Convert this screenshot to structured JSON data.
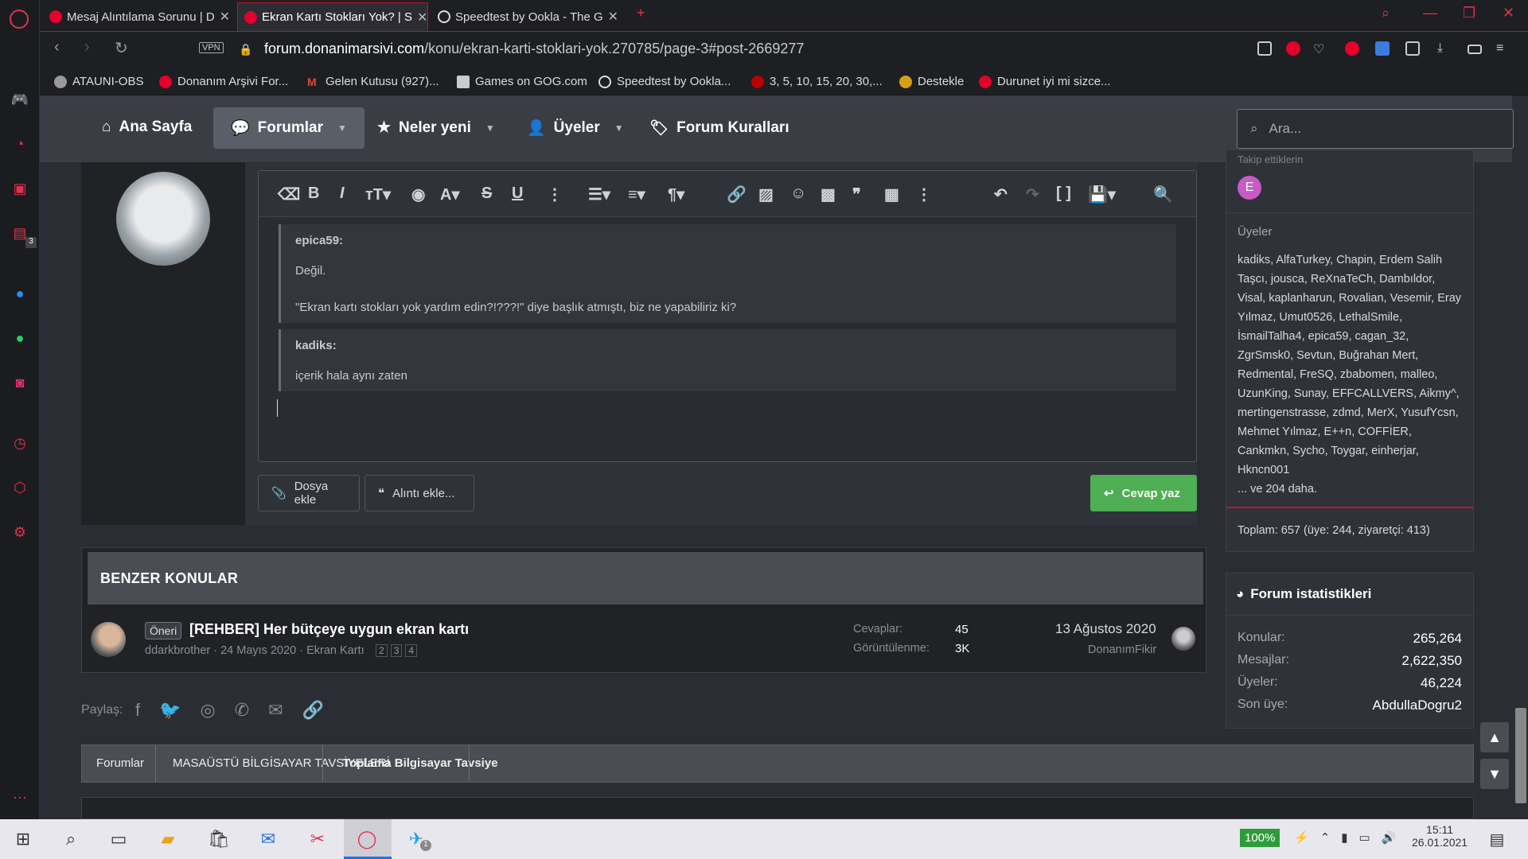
{
  "browser": {
    "tabs": [
      {
        "label": "Mesaj Alıntılama Sorunu | D"
      },
      {
        "label": "Ekran Kartı Stokları Yok? | S"
      },
      {
        "label": "Speedtest by Ookla - The G"
      }
    ],
    "vpn": "VPN",
    "url_domain": "forum.donanimarsivi.com",
    "url_path": "/konu/ekran-karti-stoklari-yok.270785/page-3#post-2669277",
    "bookmarks": [
      "ATAUNI-OBS",
      "Donanım Arşivi For...",
      "Gelen Kutusu (927)...",
      "Games on GOG.com",
      "Speedtest by Ookla...",
      "3, 5, 10, 15, 20, 30,...",
      "Destekle",
      "Durunet iyi mi sizce..."
    ],
    "sidebar_badge": "3"
  },
  "nav": {
    "items": [
      "Ana Sayfa",
      "Forumlar",
      "Neler yeni",
      "Üyeler",
      "Forum Kuralları"
    ],
    "search_placeholder": "Ara..."
  },
  "editor": {
    "quotes": [
      {
        "author": "epica59:",
        "lines": [
          "Değil.",
          "\"Ekran kartı stokları yok yardım edin?!???!\" diye başlık atmıştı, biz ne yapabiliriz ki?"
        ]
      },
      {
        "author": "kadiks:",
        "lines": [
          "içerik hala aynı zaten"
        ]
      }
    ],
    "attach_label": "Dosya ekle",
    "quote_label": "Alıntı ekle...",
    "reply_label": "Cevap yaz"
  },
  "online": {
    "following_label": "Takip ettiklerin",
    "following_avatar": "E",
    "members_label": "Üyeler",
    "members_lines": [
      "kadiks, AlfaTurkey, Chapin, Erdem Salih",
      "Taşcı, jousca, ReXnaTeCh, Dambıldor,",
      "Visal, kaplanharun, Rovalian, Vesemir, Eray",
      "Yılmaz, Umut0526, LethalSmile,",
      "İsmailTalha4, epica59, cagan_32,",
      "ZgrSmsk0, Sevtun, Buğrahan Mert,",
      "Redmental, FreSQ, zbabomen, malleo,",
      "UzunKing, Sunay, EFFCALLVERS, Aikmy^,",
      "mertingenstrasse, zdmd, MerX, YusufYcsn,",
      "Mehmet Yılmaz, E++n, COFFİER,",
      "Cankmkn, Sycho, Toygar, einherjar,",
      "Hkncn001",
      "... ve 204 daha."
    ],
    "total": "Toplam: 657 (üye: 244, ziyaretçi: 413)"
  },
  "stats": {
    "title": "Forum istatistikleri",
    "rows": [
      {
        "label": "Konular:",
        "value": "265,264"
      },
      {
        "label": "Mesajlar:",
        "value": "2,622,350"
      },
      {
        "label": "Üyeler:",
        "value": "46,224"
      },
      {
        "label": "Son üye:",
        "value": "AbdullaDogru2"
      }
    ]
  },
  "similar": {
    "title": "BENZER KONULAR",
    "thread": {
      "prefix": "Öneri",
      "title": "[REHBER] Her bütçeye uygun ekran kartı",
      "meta": "ddarkbrother · 24 Mayıs 2020 · Ekran Kartı",
      "pages": [
        "2",
        "3",
        "4"
      ],
      "replies_label": "Cevaplar:",
      "replies": "45",
      "views_label": "Görüntülenme:",
      "views": "3K",
      "last_date": "13 Ağustos 2020",
      "last_user": "DonanımFikir"
    }
  },
  "share_label": "Paylaş:",
  "breadcrumb": [
    "Forumlar",
    "MASAÜSTÜ BİLGİSAYAR TAVSİYELERİ",
    "Toplama Bilgisayar Tavsiye"
  ],
  "taskbar": {
    "battery": "100%",
    "time": "15:11",
    "date": "26.01.2021",
    "telegram_badge": "1"
  }
}
